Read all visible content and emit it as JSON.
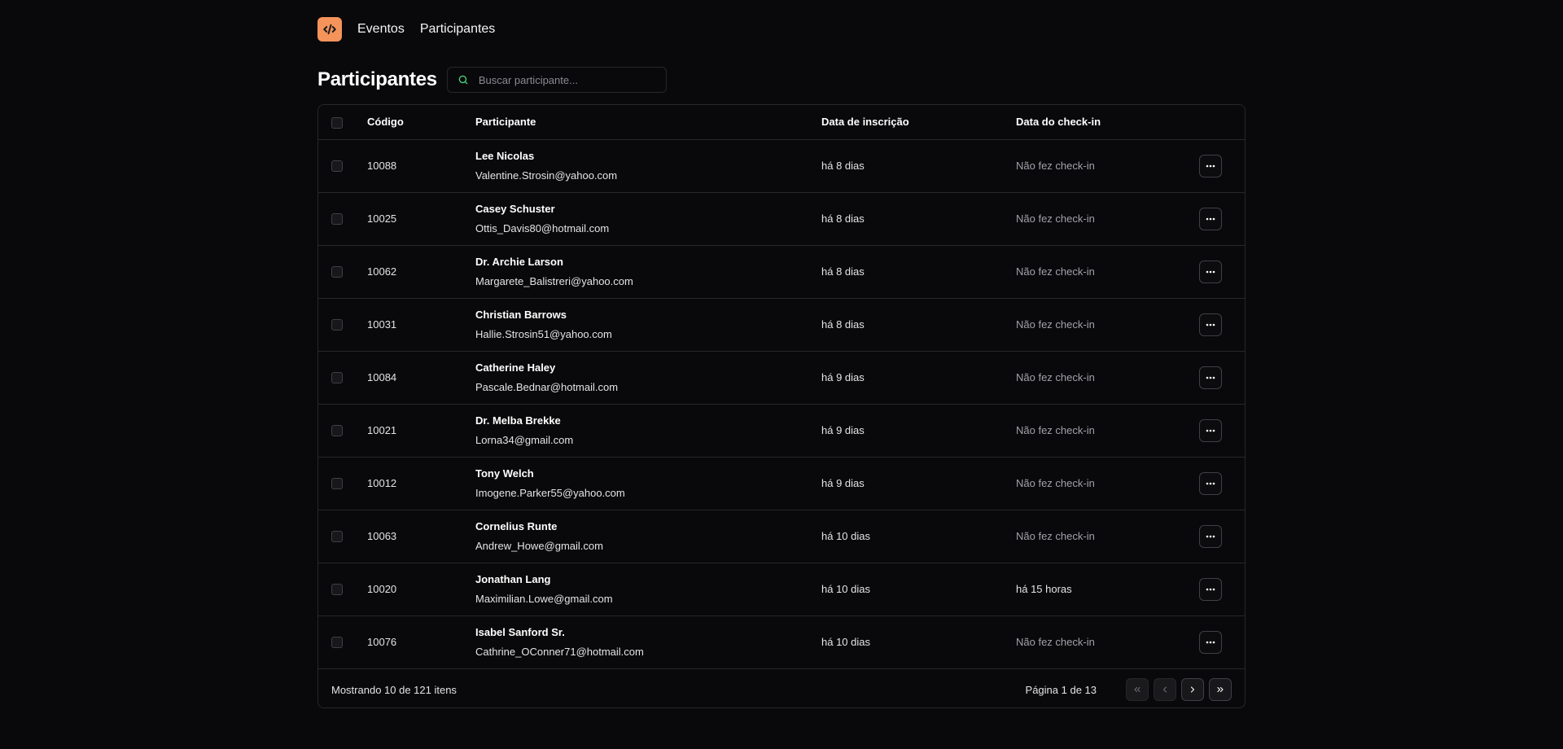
{
  "nav": {
    "logo_label": "</>",
    "links": [
      "Eventos",
      "Participantes"
    ]
  },
  "page": {
    "title": "Participantes",
    "search_placeholder": "Buscar participante..."
  },
  "table": {
    "headers": {
      "code": "Código",
      "participant": "Participante",
      "registration_date": "Data de inscrição",
      "checkin_date": "Data do check-in"
    },
    "rows": [
      {
        "code": "10088",
        "name": "Lee Nicolas",
        "email": "Valentine.Strosin@yahoo.com",
        "registered": "há 8 dias",
        "checkin": "Não fez check-in"
      },
      {
        "code": "10025",
        "name": "Casey Schuster",
        "email": "Ottis_Davis80@hotmail.com",
        "registered": "há 8 dias",
        "checkin": "Não fez check-in"
      },
      {
        "code": "10062",
        "name": "Dr. Archie Larson",
        "email": "Margarete_Balistreri@yahoo.com",
        "registered": "há 8 dias",
        "checkin": "Não fez check-in"
      },
      {
        "code": "10031",
        "name": "Christian Barrows",
        "email": "Hallie.Strosin51@yahoo.com",
        "registered": "há 8 dias",
        "checkin": "Não fez check-in"
      },
      {
        "code": "10084",
        "name": "Catherine Haley",
        "email": "Pascale.Bednar@hotmail.com",
        "registered": "há 9 dias",
        "checkin": "Não fez check-in"
      },
      {
        "code": "10021",
        "name": "Dr. Melba Brekke",
        "email": "Lorna34@gmail.com",
        "registered": "há 9 dias",
        "checkin": "Não fez check-in"
      },
      {
        "code": "10012",
        "name": "Tony Welch",
        "email": "Imogene.Parker55@yahoo.com",
        "registered": "há 9 dias",
        "checkin": "Não fez check-in"
      },
      {
        "code": "10063",
        "name": "Cornelius Runte",
        "email": "Andrew_Howe@gmail.com",
        "registered": "há 10 dias",
        "checkin": "Não fez check-in"
      },
      {
        "code": "10020",
        "name": "Jonathan Lang",
        "email": "Maximilian.Lowe@gmail.com",
        "registered": "há 10 dias",
        "checkin": "há 15 horas"
      },
      {
        "code": "10076",
        "name": "Isabel Sanford Sr.",
        "email": "Cathrine_OConner71@hotmail.com",
        "registered": "há 10 dias",
        "checkin": "Não fez check-in"
      }
    ]
  },
  "footer": {
    "showing": "Mostrando 10 de 121 itens",
    "page_info": "Página 1 de 13"
  },
  "colors": {
    "background": "#09090b",
    "accent": "#f4935a",
    "border": "#27272a",
    "search_icon": "#4ade80"
  },
  "icons": {
    "logo": "code-icon",
    "search": "search-icon",
    "row_action": "more-horizontal-icon",
    "first": "chevrons-left-icon",
    "prev": "chevron-left-icon",
    "next": "chevron-right-icon",
    "last": "chevrons-right-icon"
  }
}
